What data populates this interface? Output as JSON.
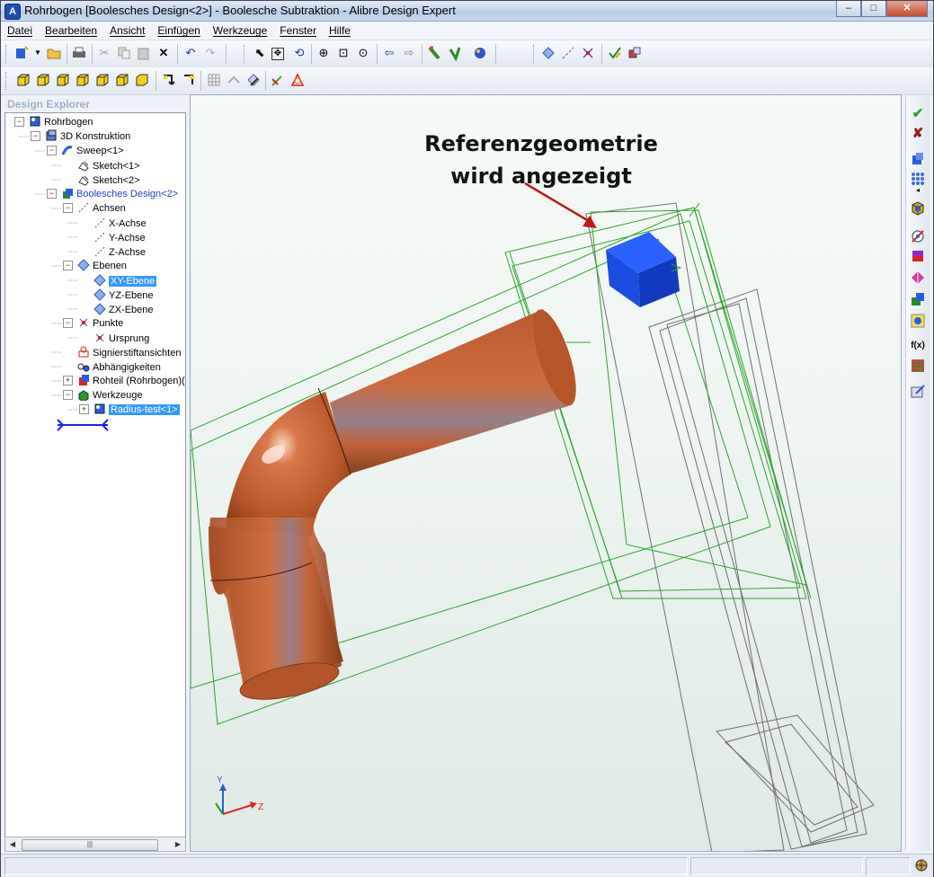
{
  "window": {
    "title": "Rohrbogen [Boolesches Design<2>] - Boolesche Subtraktion - Alibre Design Expert",
    "minimize_glyph": "–",
    "maximize_glyph": "□",
    "close_glyph": "✕"
  },
  "menu": {
    "items": [
      "Datei",
      "Bearbeiten",
      "Ansicht",
      "Einfügen",
      "Werkzeuge",
      "Fenster",
      "Hilfe"
    ]
  },
  "explorer": {
    "header": "Design Explorer",
    "tree": [
      {
        "label": "Rohrbogen",
        "depth": 0,
        "expander": "−",
        "icon": "part-icon"
      },
      {
        "label": "3D Konstruktion",
        "depth": 1,
        "expander": "−",
        "icon": "construction-icon"
      },
      {
        "label": "Sweep<1>",
        "depth": 2,
        "expander": "−",
        "icon": "sweep-icon"
      },
      {
        "label": "Sketch<1>",
        "depth": 3,
        "expander": "",
        "icon": "sketch-icon"
      },
      {
        "label": "Sketch<2>",
        "depth": 3,
        "expander": "",
        "icon": "sketch-icon"
      },
      {
        "label": "Boolesches Design<2>",
        "depth": 2,
        "expander": "−",
        "icon": "boolean-icon",
        "style": "link"
      },
      {
        "label": "Achsen",
        "depth": 3,
        "expander": "−",
        "icon": "axis-icon"
      },
      {
        "label": "X-Achse",
        "depth": 4,
        "expander": "",
        "icon": "axis-icon"
      },
      {
        "label": "Y-Achse",
        "depth": 4,
        "expander": "",
        "icon": "axis-icon"
      },
      {
        "label": "Z-Achse",
        "depth": 4,
        "expander": "",
        "icon": "axis-icon"
      },
      {
        "label": "Ebenen",
        "depth": 3,
        "expander": "−",
        "icon": "plane-icon"
      },
      {
        "label": "XY-Ebene",
        "depth": 4,
        "expander": "",
        "icon": "plane-icon",
        "style": "selected"
      },
      {
        "label": "YZ-Ebene",
        "depth": 4,
        "expander": "",
        "icon": "plane-icon"
      },
      {
        "label": "ZX-Ebene",
        "depth": 4,
        "expander": "",
        "icon": "plane-icon"
      },
      {
        "label": "Punkte",
        "depth": 3,
        "expander": "−",
        "icon": "point-icon"
      },
      {
        "label": "Ursprung",
        "depth": 4,
        "expander": "",
        "icon": "point-icon"
      },
      {
        "label": "Signierstiftansichten",
        "depth": 3,
        "expander": "",
        "icon": "marker-icon"
      },
      {
        "label": "Abhängigkeiten",
        "depth": 3,
        "expander": "",
        "icon": "constraint-icon"
      },
      {
        "label": "Rohteil (Rohrbogen)(",
        "depth": 3,
        "expander": "+",
        "icon": "stock-icon"
      },
      {
        "label": "Werkzeuge",
        "depth": 3,
        "expander": "−",
        "icon": "tools-icon"
      },
      {
        "label": "Radius-test<1>",
        "depth": 4,
        "expander": "+",
        "icon": "tool-part-icon",
        "style": "selected-outline"
      }
    ],
    "scroll_glyph": "|||"
  },
  "viewport": {
    "annotation_line1": "Referenzgeometrie",
    "annotation_line2": "wird angezeigt",
    "triad": {
      "x": "Z",
      "y": "Y"
    },
    "colors": {
      "pipe": "#c8653a",
      "pipe_dark": "#8c3f1e",
      "reference_planes": "#22aa22",
      "tool_block": "#1a4fe0",
      "arrow": "#c0181c",
      "wireframe": "#7a7a7a"
    }
  },
  "toolbar1": {
    "icons": [
      "new-icon",
      "open-icon",
      "print-icon",
      "cut-icon",
      "copy-icon",
      "paste-icon",
      "delete-icon",
      "undo-icon",
      "redo-icon",
      "select-icon",
      "pan-icon",
      "rotate-icon",
      "zoom-in-icon",
      "zoom-window-icon",
      "zoom-fit-icon",
      "back-icon",
      "forward-icon",
      "feature-icon",
      "sweep-tool-icon",
      "render-icon",
      "plane-tool-icon",
      "axis-tool-icon",
      "point-tool-icon",
      "check-tool-icon",
      "measure-icon"
    ]
  },
  "toolbar2": {
    "icons": [
      "view-front-icon",
      "view-back-icon",
      "view-left-icon",
      "view-right-icon",
      "view-top-icon",
      "view-bottom-icon",
      "view-iso1-icon",
      "view-iso2-icon",
      "grid-icon",
      "section-icon",
      "section-plane-icon",
      "edit-sketch-icon",
      "sketch-tool-icon"
    ]
  },
  "right_toolbar": {
    "ok_glyph": "✔",
    "cancel_glyph": "✘",
    "fx_label": "f(x)"
  }
}
